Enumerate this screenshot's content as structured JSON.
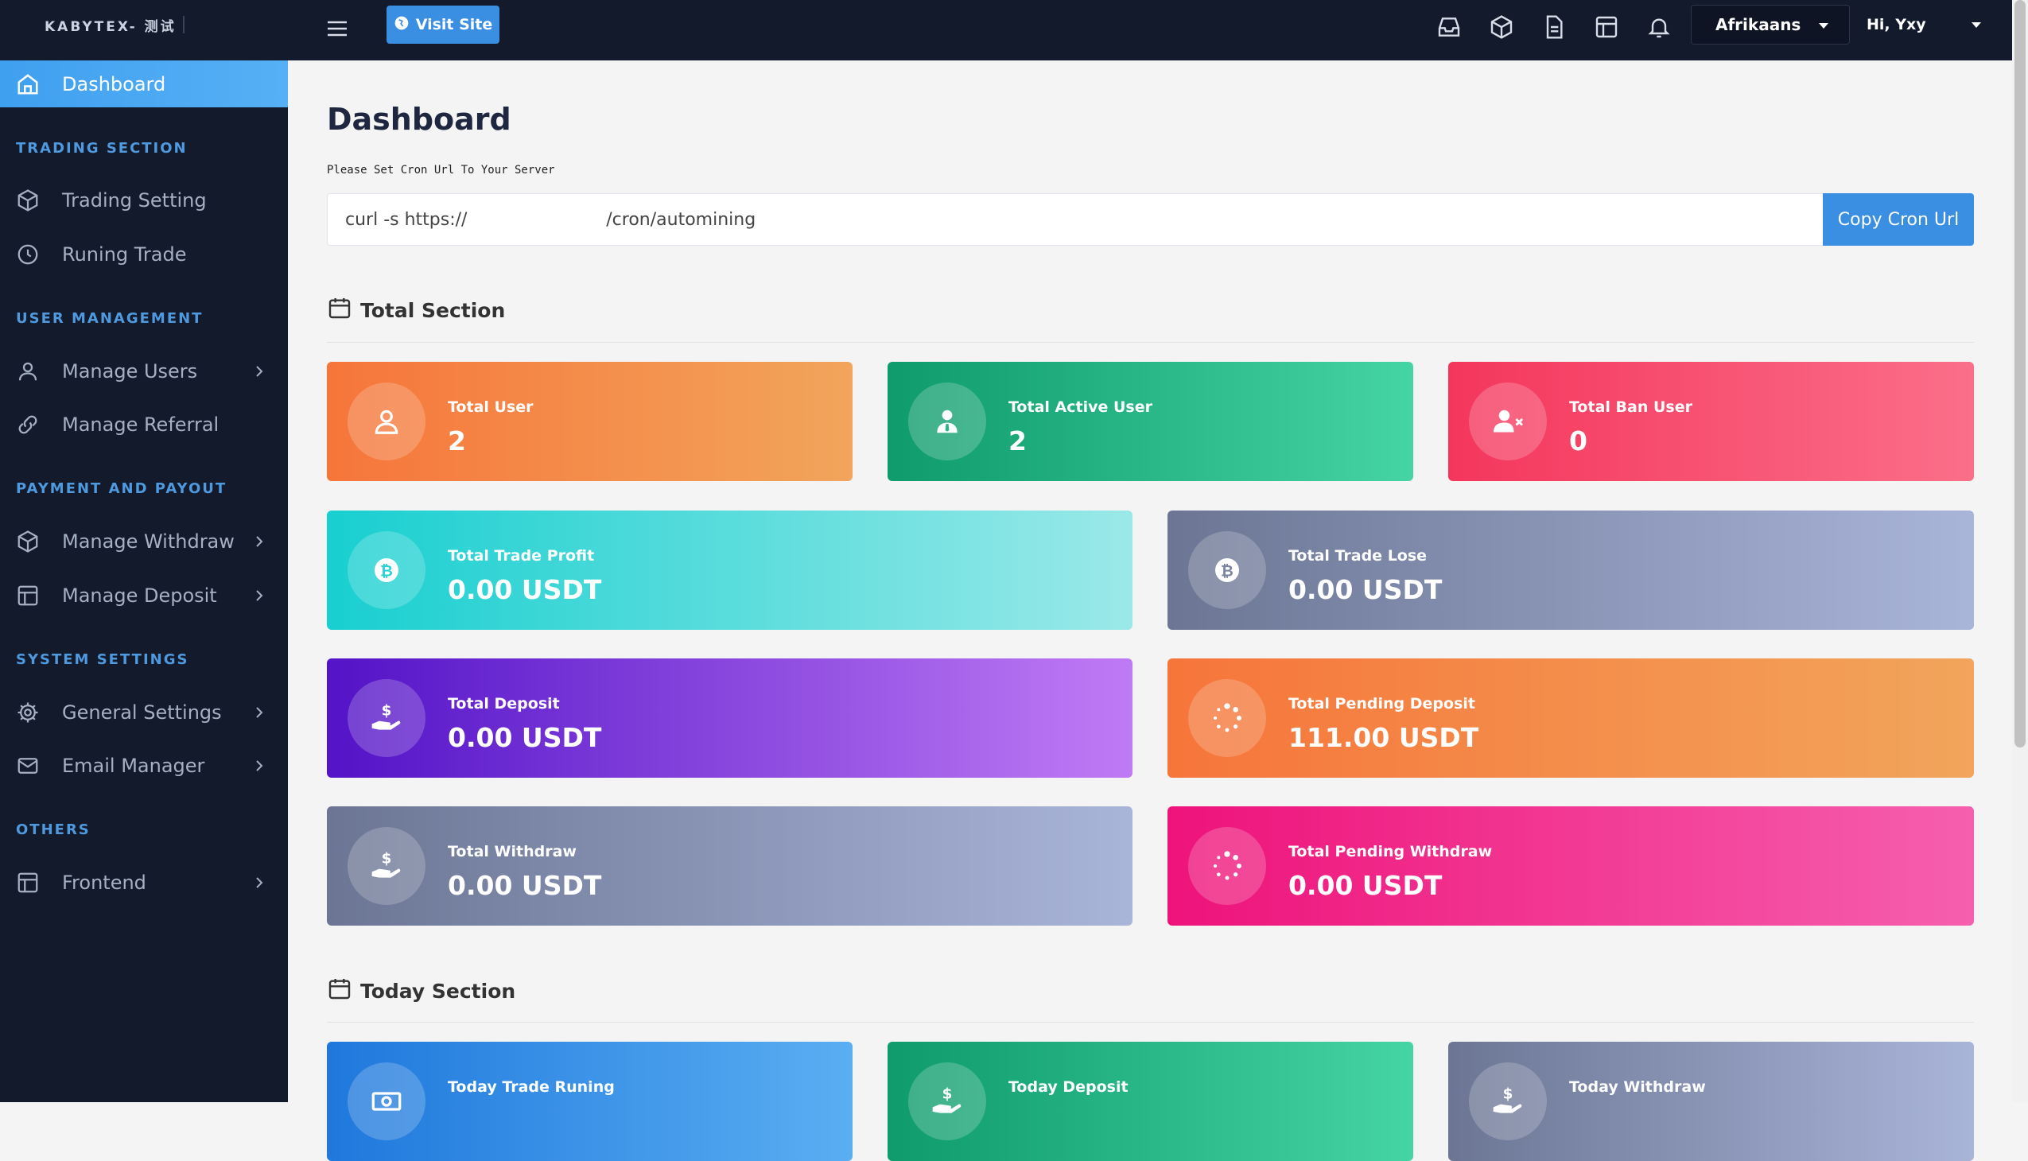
{
  "brand": {
    "name": "KABYTEX- 测试"
  },
  "sidebar": {
    "active": {
      "label": "Dashboard",
      "icon": "home-icon"
    },
    "sections": [
      {
        "title": "TRADING SECTION"
      },
      {
        "title": "USER MANAGEMENT"
      },
      {
        "title": "PAYMENT AND PAYOUT"
      },
      {
        "title": "SYSTEM SETTINGS"
      },
      {
        "title": "OTHERS"
      }
    ],
    "items": [
      {
        "label": "Trading Setting",
        "icon": "cube-icon"
      },
      {
        "label": "Runing Trade",
        "icon": "clock-icon"
      },
      {
        "label": "Manage Users",
        "icon": "user-icon"
      },
      {
        "label": "Manage Referral",
        "icon": "link-icon"
      },
      {
        "label": "Manage Withdraw",
        "icon": "cube-icon"
      },
      {
        "label": "Manage Deposit",
        "icon": "table-icon"
      },
      {
        "label": "General Settings",
        "icon": "gear-icon"
      },
      {
        "label": "Email Manager",
        "icon": "mail-icon"
      },
      {
        "label": "Frontend",
        "icon": "layout-icon"
      }
    ]
  },
  "topbar": {
    "visit_label": "Visit Site",
    "language": "Afrikaans",
    "greeting": "Hi, Yxy"
  },
  "main": {
    "title": "Dashboard",
    "cron_label": "Please Set Cron Url To Your Server",
    "cron_url": "curl -s https://                         /cron/automining",
    "copy_label": "Copy Cron Url",
    "total_section": "Total Section",
    "today_section": "Today Section"
  },
  "cards": {
    "total_user": {
      "label": "Total User",
      "value": "2"
    },
    "total_active_user": {
      "label": "Total Active User",
      "value": "2"
    },
    "total_ban_user": {
      "label": "Total Ban User",
      "value": "0"
    },
    "total_trade_profit": {
      "label": "Total Trade Profit",
      "value": "0.00 USDT"
    },
    "total_trade_lose": {
      "label": "Total Trade Lose",
      "value": "0.00 USDT"
    },
    "total_deposit": {
      "label": "Total Deposit",
      "value": "0.00 USDT"
    },
    "total_pending_deposit": {
      "label": "Total Pending Deposit",
      "value": "111.00 USDT"
    },
    "total_withdraw": {
      "label": "Total Withdraw",
      "value": "0.00 USDT"
    },
    "total_pending_withdraw": {
      "label": "Total Pending Withdraw",
      "value": "0.00 USDT"
    },
    "today_trade_runing": {
      "label": "Today Trade Runing"
    },
    "today_deposit": {
      "label": "Today Deposit"
    },
    "today_withdraw": {
      "label": "Today Withdraw"
    }
  },
  "colors": {
    "sidebar_bg": "#131a2c",
    "accent": "#3a8fe2",
    "section_title": "#4f99df"
  }
}
